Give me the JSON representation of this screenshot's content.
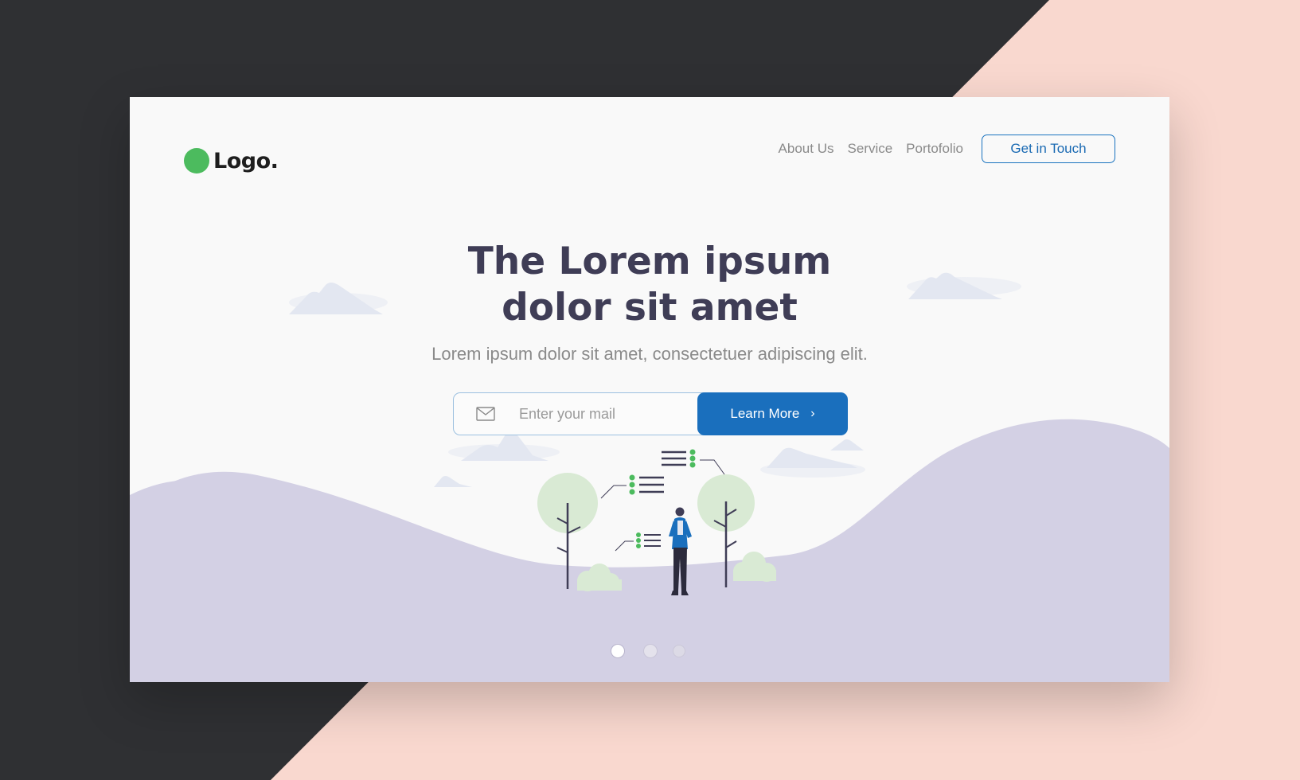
{
  "colors": {
    "background_dark": "#2f3033",
    "background_peach": "#f9d8cf",
    "card": "#f9f9f9",
    "hill": "#d3d0e4",
    "accent": "#1a6fbd",
    "logo_dot": "#4cbb5e",
    "heading": "#3f3d56",
    "tree": "#d9ead4",
    "cloud": "#e3e7f1"
  },
  "logo": {
    "text": "Logo.",
    "icon": "green-circle"
  },
  "nav": {
    "items": [
      {
        "label": "About Us"
      },
      {
        "label": "Service"
      },
      {
        "label": "Portofolio"
      }
    ],
    "cta_label": "Get in Touch"
  },
  "hero": {
    "title_line1": "The Lorem ipsum",
    "title_line2": "dolor sit amet",
    "subtitle": "Lorem ipsum dolor sit amet, consectetuer adipiscing elit."
  },
  "form": {
    "icon": "mail-icon",
    "placeholder": "Enter your mail",
    "value": "",
    "button_label": "Learn More",
    "button_icon": "chevron-right-icon"
  },
  "illustration": {
    "subject": "person-standing-between-trees",
    "icons": [
      "checklist-icon",
      "checklist-icon",
      "checklist-icon"
    ]
  },
  "carousel": {
    "slide_count": 3,
    "active_index": 0
  }
}
